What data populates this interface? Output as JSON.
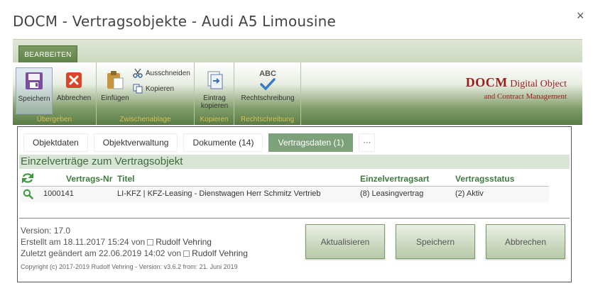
{
  "window": {
    "title": "DOCM - Vertragsobjekte - Audi A5 Limousine",
    "close_glyph": "×"
  },
  "ribbon": {
    "tab_label": "BEARBEITEN",
    "groups": {
      "uebergeben": {
        "label": "Übergeben",
        "save": "Speichern",
        "cancel": "Abbrechen"
      },
      "zwischenablage": {
        "label": "Zwischenablage",
        "paste": "Einfügen",
        "cut": "Ausschneiden",
        "copy": "Kopieren"
      },
      "kopieren": {
        "label": "Kopieren",
        "copy_entry_1": "Eintrag",
        "copy_entry_2": "kopieren"
      },
      "rechtschreibung": {
        "label": "Rechtschreibung",
        "spelling": "Rechtschreibung",
        "abc": "ABC"
      }
    },
    "brand": {
      "line1_strong": "DOCM",
      "line1_rest": "Digital Object",
      "line2": "and Contract Management"
    },
    "colors": {
      "brand": "#9b1c1c",
      "group_label": "#d6c255",
      "ribbon_dark": "#5c7d47"
    }
  },
  "tabs": [
    {
      "label": "Objektdaten"
    },
    {
      "label": "Objektverwaltung"
    },
    {
      "label": "Dokumente (14)"
    },
    {
      "label": "Vertragsdaten (1)",
      "active": true
    },
    {
      "label": "···"
    }
  ],
  "section": {
    "title": "Einzelverträge zum Vertragsobjekt"
  },
  "grid": {
    "columns": {
      "nr": "Vertrags-Nr",
      "title": "Titel",
      "type": "Einzelvertragsart",
      "status": "Vertragsstatus"
    },
    "rows": [
      {
        "nr": "1000141",
        "title": "LI-KFZ | KFZ-Leasing - Dienstwagen Herr Schmitz Vertrieb",
        "type": "(8) Leasingvertrag",
        "status": "(2) Aktiv"
      }
    ]
  },
  "info": {
    "version": "Version: 17.0",
    "created_prefix": "Erstellt am 18.11.2017 15:24  von",
    "created_user": "Rudolf Vehring",
    "modified_prefix": "Zuletzt geändert am 22.06.2019 14:02  von",
    "modified_user": "Rudolf Vehring",
    "copyright": "Copyright (c) 2017-2019 Rudolf Vehring - Version: v3.6.2 from: 21. Juni 2019"
  },
  "actions": {
    "refresh": "Aktualisieren",
    "save": "Speichern",
    "cancel": "Abbrechen"
  }
}
